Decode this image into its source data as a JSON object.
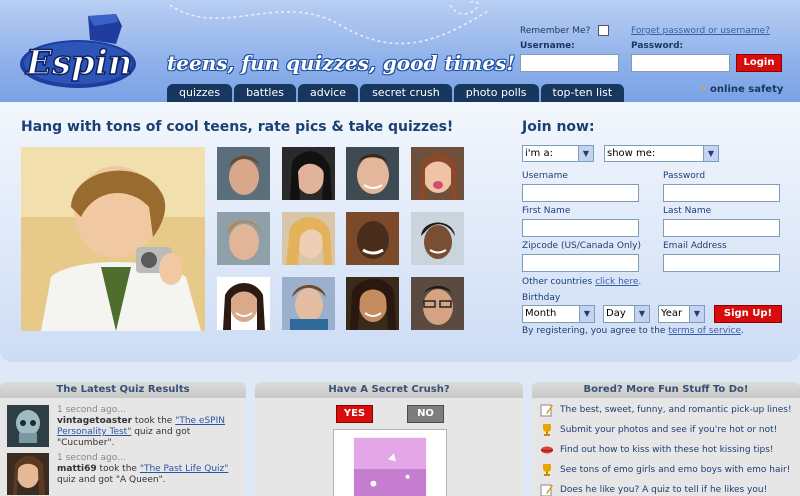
{
  "header": {
    "logo_text": "Espin",
    "tagline": "teens, fun quizzes, good times!",
    "tabs": [
      "quizzes",
      "battles",
      "advice",
      "secret crush",
      "photo polls",
      "top-ten list"
    ],
    "online_safety": "online safety"
  },
  "login": {
    "remember_label": "Remember Me?",
    "forgot_link": "Forget password or username?",
    "username_label": "Username:",
    "password_label": "Password:",
    "login_button": "Login"
  },
  "main": {
    "headline": "Hang with tons of cool teens, rate pics & take quizzes!"
  },
  "join": {
    "title": "Join now:",
    "im_a": "i'm a:",
    "show_me": "show me:",
    "username": "Username",
    "password": "Password",
    "first_name": "First Name",
    "last_name": "Last Name",
    "zipcode": "Zipcode (US/Canada Only)",
    "email": "Email Address",
    "other_countries": "Other countries",
    "click_here": "click here",
    "other_countries_end": ".",
    "birthday": "Birthday",
    "month": "Month",
    "day": "Day",
    "year": "Year",
    "signup_button": "Sign Up!",
    "terms_prefix": "By registering, you agree to the",
    "terms_link": "terms of service",
    "terms_end": "."
  },
  "quiz_results": {
    "title": "The Latest Quiz Results",
    "items": [
      {
        "time": "1 second ago...",
        "user": "vintagetoaster",
        "took": "took the",
        "quiz": "\"The eSPIN Personality Test\"",
        "got": "quiz and got \"Cucumber\"."
      },
      {
        "time": "1 second ago...",
        "user": "matti69",
        "took": "took the",
        "quiz": "\"The Past Life Quiz\"",
        "got": "quiz and got \"A Queen\"."
      }
    ]
  },
  "secret_crush": {
    "title": "Have A Secret Crush?",
    "yes": "YES",
    "no": "NO"
  },
  "fun_stuff": {
    "title": "Bored? More Fun Stuff To Do!",
    "items": [
      {
        "icon": "pencil-note-icon",
        "text": "The best, sweet, funny, and romantic pick-up lines!"
      },
      {
        "icon": "trophy-icon",
        "text": "Submit your photos and see if you're hot or not!"
      },
      {
        "icon": "lips-icon",
        "text": "Find out how to kiss with these hot kissing tips!"
      },
      {
        "icon": "trophy-icon",
        "text": "See tons of emo girls and emo boys with emo hair!"
      },
      {
        "icon": "pencil-note-icon",
        "text": "Does he like you? A quiz to tell if he likes you!"
      }
    ]
  },
  "colors": {
    "accent_red": "#d70d0d",
    "tab_navy": "#17375f",
    "heading_blue": "#1c3f74"
  }
}
